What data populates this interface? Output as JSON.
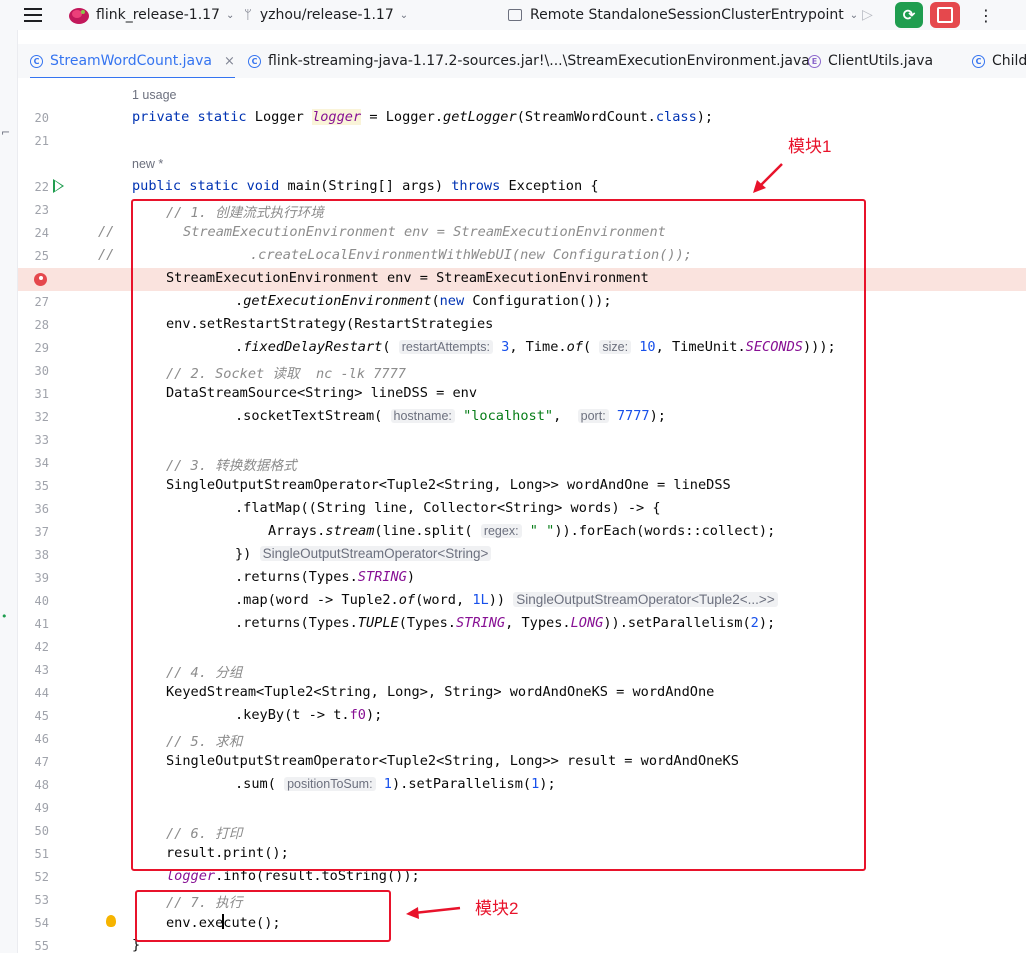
{
  "titlebar": {
    "project": "flink_release-1.17",
    "branch": "yzhou/release-1.17",
    "run_config": "Remote StandaloneSessionClusterEntrypoint"
  },
  "tabs": [
    {
      "label": "StreamWordCount.java",
      "active": true,
      "icon": "class-icon"
    },
    {
      "label": "flink-streaming-java-1.17.2-sources.jar!\\...\\StreamExecutionEnvironment.java",
      "active": false,
      "icon": "class-icon"
    },
    {
      "label": "ClientUtils.java",
      "active": false,
      "icon": "enum-icon"
    },
    {
      "label": "Child",
      "active": false,
      "icon": "class-icon"
    }
  ],
  "hints": {
    "usage": "1 usage",
    "new": "new *",
    "restartAttempts": "restartAttempts:",
    "size": "size:",
    "hostname": "hostname:",
    "port": "port:",
    "regex": "regex:",
    "type_hint_1": "SingleOutputStreamOperator<String>",
    "type_hint_2": "SingleOutputStreamOperator<Tuple2<...>>",
    "positionToSum": "positionToSum:"
  },
  "line_numbers": [
    "20",
    "21",
    "22",
    "23",
    "24",
    "25",
    "26",
    "27",
    "28",
    "29",
    "30",
    "31",
    "32",
    "33",
    "34",
    "35",
    "36",
    "37",
    "38",
    "39",
    "40",
    "41",
    "42",
    "43",
    "44",
    "45",
    "46",
    "47",
    "48",
    "49",
    "50",
    "51",
    "52",
    "53",
    "54",
    "55"
  ],
  "comments": {
    "c1": "// 1. 创建流式执行环境",
    "c2": "// 2. Socket 读取  nc -lk 7777",
    "c3": "// 3. 转换数据格式",
    "c4": "// 4. 分组",
    "c5": "// 5. 求和",
    "c6": "// 6. 打印",
    "c7": "// 7. 执行"
  },
  "annotations": {
    "module1": "模块1",
    "module2": "模块2"
  },
  "colors": {
    "annotation_red": "#e8132b",
    "accent_blue": "#3574f0",
    "debug_green": "#1f9d4f",
    "stop_red": "#e5484d"
  }
}
